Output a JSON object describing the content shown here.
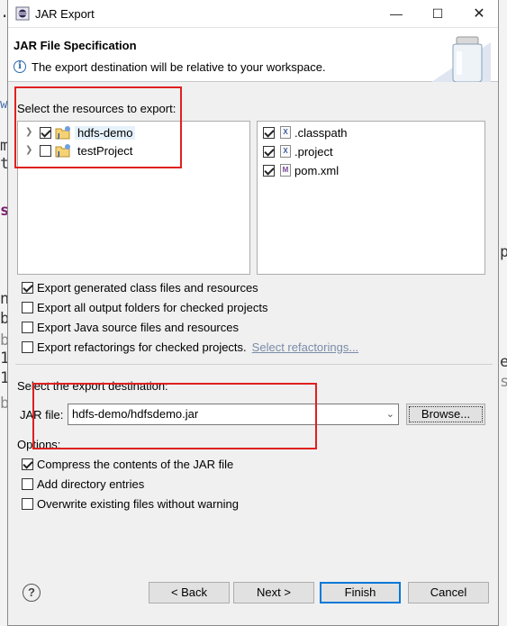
{
  "window": {
    "title": "JAR Export",
    "minimize_icon": "minimize-icon",
    "maximize_icon": "maximize-icon",
    "close_icon": "close-icon"
  },
  "banner": {
    "title": "JAR File Specification",
    "message": "The export destination will be relative to your workspace.",
    "info_icon": "info-icon",
    "image_icon": "jar-image-icon"
  },
  "resources": {
    "label": "Select the resources to export:",
    "projects": [
      {
        "name": "hdfs-demo",
        "checked": true,
        "icon": "project-icon"
      },
      {
        "name": "testProject",
        "checked": false,
        "icon": "project-icon"
      }
    ],
    "files": [
      {
        "name": ".classpath",
        "checked": true,
        "icon": "xml-file-icon"
      },
      {
        "name": ".project",
        "checked": true,
        "icon": "xml-file-icon"
      },
      {
        "name": "pom.xml",
        "checked": true,
        "icon": "maven-file-icon"
      }
    ]
  },
  "export_options": [
    {
      "label": "Export generated class files and resources",
      "checked": true
    },
    {
      "label": "Export all output folders for checked projects",
      "checked": false
    },
    {
      "label": "Export Java source files and resources",
      "checked": false
    },
    {
      "label": "Export refactorings for checked projects.",
      "checked": false
    }
  ],
  "select_refactorings_link": "Select refactorings...",
  "destination": {
    "label": "Select the export destination:",
    "jar_file_label": "JAR file:",
    "jar_file_value": "hdfs-demo/hdfsdemo.jar",
    "browse_label": "Browse..."
  },
  "options": {
    "label": "Options:",
    "items": [
      {
        "label": "Compress the contents of the JAR file",
        "checked": true
      },
      {
        "label": "Add directory entries",
        "checked": false
      },
      {
        "label": "Overwrite existing files without warning",
        "checked": false
      }
    ]
  },
  "footer": {
    "help_icon": "help-icon",
    "back_label": "< Back",
    "next_label": "Next >",
    "finish_label": "Finish",
    "cancel_label": "Cancel"
  },
  "colors": {
    "annotation_red": "#e02020",
    "default_button_border": "#0078d7",
    "link": "#7a8ca8"
  },
  "background_fragments": [
    ".",
    "w",
    "m",
    "t",
    "s",
    "n",
    "b",
    "b",
    "1",
    "1",
    "b",
    "e",
    "s",
    "p"
  ]
}
